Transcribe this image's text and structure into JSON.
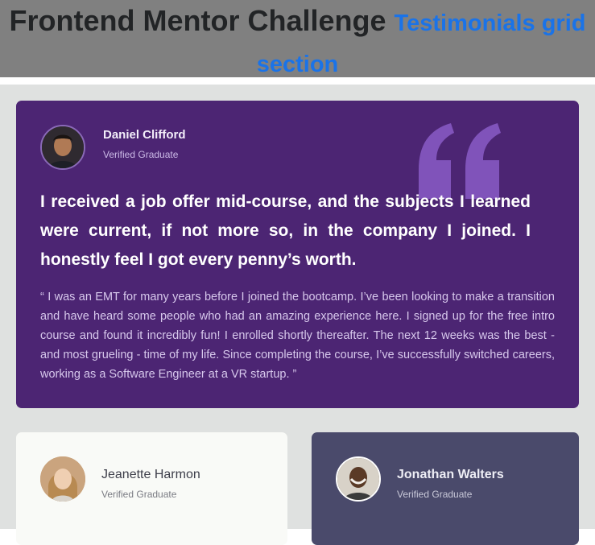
{
  "header": {
    "title": "Frontend Mentor Challenge",
    "subtitle": "Testimonials grid section"
  },
  "testimonials": [
    {
      "name": "Daniel Clifford",
      "role": "Verified Graduate",
      "headline": "I received a job offer mid-course, and the subjects I learned were current, if not more so, in the company I joined. I honestly feel I got every penny’s worth.",
      "quote": "“ I was an EMT for many years before I joined the bootcamp. I’ve been looking to make a transition and have heard some people who had an amazing experience here. I signed up for the free intro course and found it incredibly fun! I enrolled shortly thereafter. The next 12 weeks was the best - and most grueling - time of my life. Since completing the course, I’ve successfully switched careers, working as a Software Engineer at a VR startup. ”"
    },
    {
      "name": "Jeanette Harmon",
      "role": "Verified Graduate"
    },
    {
      "name": "Jonathan Walters",
      "role": "Verified Graduate"
    }
  ],
  "colors": {
    "header_bg": "#808080",
    "accent_blue": "#1a73e8",
    "page_bg": "#dfe1e0",
    "featured_card": "#4c2573",
    "white_card": "#f9faf7",
    "slate_card": "#4a4a6b",
    "quote_mark": "#8a5cc7"
  },
  "icons": [
    "quotation-mark-icon"
  ]
}
